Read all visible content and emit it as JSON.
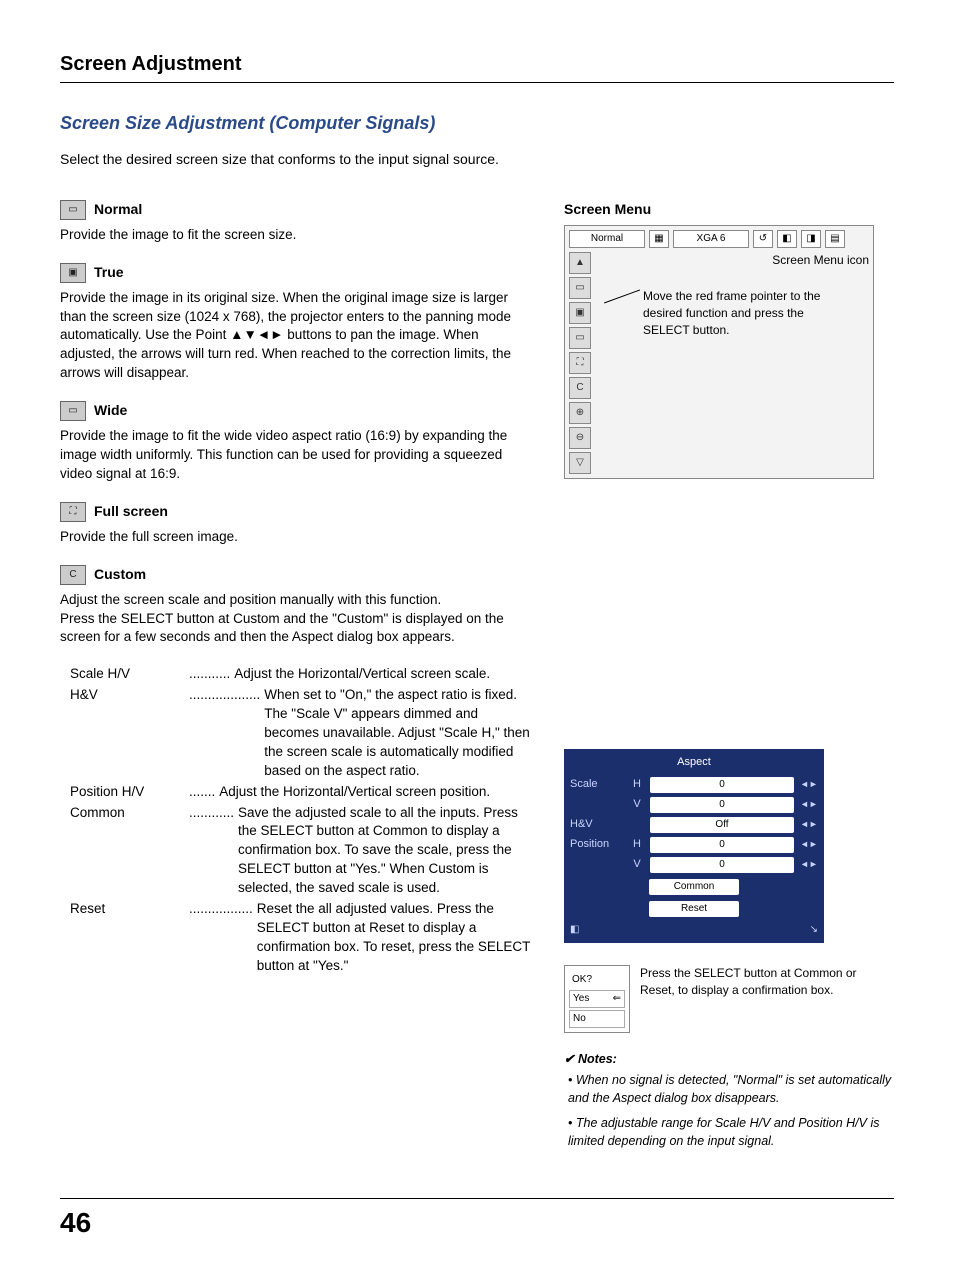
{
  "page": {
    "section_title": "Screen Adjustment",
    "subsection_title": "Screen Size Adjustment (Computer Signals)",
    "intro": "Select the desired screen size that conforms to the input signal source.",
    "page_number": "46"
  },
  "modes": {
    "normal": {
      "label": "Normal",
      "desc": "Provide the image to fit the screen size."
    },
    "true_": {
      "label": "True",
      "desc_pre": "Provide the image in its original size. When the original image size is larger than the screen size (1024 x 768), the projector enters to the panning mode automatically. Use the Point ",
      "desc_post": " buttons to pan the image. When adjusted, the arrows will turn red. When reached to the correction limits, the arrows will disappear."
    },
    "wide": {
      "label": "Wide",
      "desc": "Provide the image to fit the wide video aspect ratio (16:9) by expanding the image width uniformly. This function can be used for providing a squeezed video signal at 16:9."
    },
    "fullscreen": {
      "label": "Full screen",
      "desc": "Provide the full screen image."
    },
    "custom": {
      "label": "Custom",
      "desc1": "Adjust the screen scale and position manually with this function.",
      "desc2": "Press the SELECT button at Custom and the \"Custom\" is displayed on the screen for a few seconds and then the Aspect dialog box appears."
    }
  },
  "custom_defs": [
    {
      "term": "Scale H/V",
      "dots": "...........",
      "desc": "Adjust the Horizontal/Vertical screen scale."
    },
    {
      "term": "H&V",
      "dots": "...................",
      "desc": "When set to \"On,\" the aspect ratio is fixed. The \"Scale V\" appears dimmed and becomes unavailable. Adjust \"Scale H,\" then the screen scale is automatically modified based on the aspect ratio."
    },
    {
      "term": "Position H/V",
      "dots": ".......",
      "desc": "Adjust the Horizontal/Vertical screen position."
    },
    {
      "term": "Common",
      "dots": "............",
      "desc": "Save the adjusted scale to all the inputs. Press the SELECT button at Common to display a confirmation box. To save the scale, press the SELECT button at \"Yes.\" When Custom is selected, the saved scale is used."
    },
    {
      "term": "Reset",
      "dots": ".................",
      "desc": "Reset the all adjusted values. Press the SELECT button at Reset to display a confirmation box. To reset, press the SELECT button at \"Yes.\""
    }
  ],
  "right": {
    "heading": "Screen Menu",
    "top_label": "Normal",
    "top_mode": "XGA 6",
    "callout1": "Screen Menu icon",
    "callout2": "Move the red frame pointer to the desired function and press the SELECT button."
  },
  "aspect": {
    "title": "Aspect",
    "scale_label": "Scale",
    "hv_h": "H",
    "hv_v": "V",
    "scale_h_val": "0",
    "scale_v_val": "0",
    "hv_label": "H&V",
    "hv_val": "Off",
    "pos_label": "Position",
    "pos_h_val": "0",
    "pos_v_val": "0",
    "common_btn": "Common",
    "reset_btn": "Reset"
  },
  "confirm": {
    "ok": "OK?",
    "yes": "Yes",
    "no": "No",
    "text": "Press the SELECT button at Common or Reset, to display a confirmation box."
  },
  "notes": {
    "title": "Notes:",
    "items": [
      "When no signal is detected, \"Normal\" is set automatically and the Aspect dialog box disappears.",
      "The adjustable range for Scale H/V and Position H/V is limited depending on the input signal."
    ]
  }
}
